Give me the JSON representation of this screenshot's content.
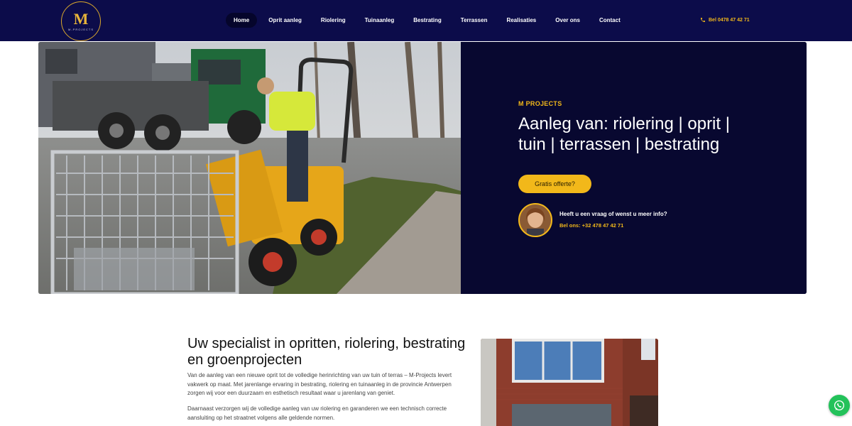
{
  "header": {
    "logo_mark": "M",
    "logo_text": "M-PROJECTS",
    "nav": [
      "Home",
      "Oprit aanleg",
      "Riolering",
      "Tuinaanleg",
      "Bestrating",
      "Terrassen",
      "Realisaties",
      "Over ons",
      "Contact"
    ],
    "active_nav": "Home",
    "phone_label": "Bel 0478 47 42 71"
  },
  "hero": {
    "eyebrow": "M PROJECTS",
    "title": "Aanleg van: riolering | oprit | tuin | terrassen | bestrating",
    "cta_label": "Gratis offerte?",
    "contact_question": "Heeft u een vraag of wenst u meer info?",
    "contact_call": "Bel ons: +32 478 47 42 71"
  },
  "intro": {
    "title": "Uw specialist in opritten, riolering, bestrating en groenprojecten",
    "paragraph1": "Van de aanleg van een nieuwe oprit tot de volledige herinrichting van uw tuin of terras – M-Projects levert vakwerk op maat. Met jarenlange ervaring in bestrating, riolering en tuinaanleg in de provincie Antwerpen zorgen wij voor een duurzaam en esthetisch resultaat waar u jarenlang van geniet.",
    "paragraph2": "Daarnaast verzorgen wij de volledige aanleg van uw riolering en garanderen we een technisch correcte aansluiting op het straatnet volgens alle geldende normen."
  },
  "colors": {
    "header_bg": "#0c0c4a",
    "hero_panel_bg": "#080830",
    "accent": "#f2b81a",
    "whatsapp": "#23c25a"
  },
  "icons": {
    "phone": "phone-icon",
    "whatsapp": "whatsapp-icon"
  }
}
